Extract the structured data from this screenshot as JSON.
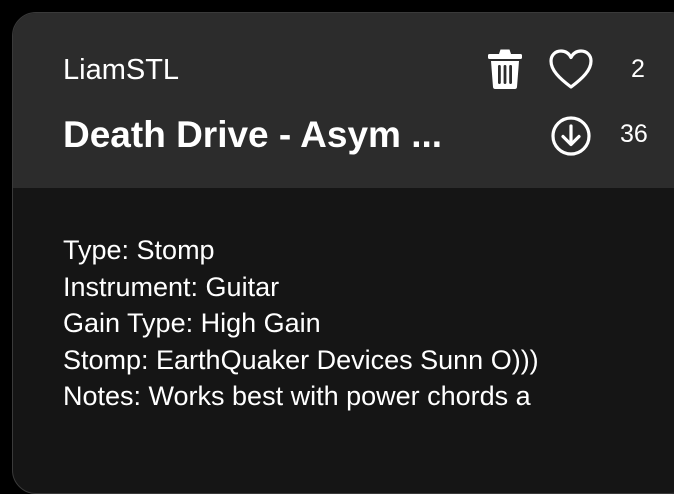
{
  "preset_card": {
    "author": "LiamSTL",
    "title": "Death Drive - Asym ...",
    "likes": "2",
    "downloads": "36",
    "details": {
      "type": "Type: Stomp",
      "instrument": "Instrument: Guitar",
      "gain_type": "Gain Type: High Gain",
      "stomp": "Stomp: EarthQuaker Devices Sunn O)))",
      "notes": "Notes: Works best with power chords a"
    },
    "icons": {
      "delete": "trash-icon",
      "like": "heart-icon",
      "download": "download-icon"
    }
  },
  "colors": {
    "background": "#000000",
    "card_body": "#151515",
    "card_header": "#2c2c2c",
    "text": "#ffffff"
  }
}
